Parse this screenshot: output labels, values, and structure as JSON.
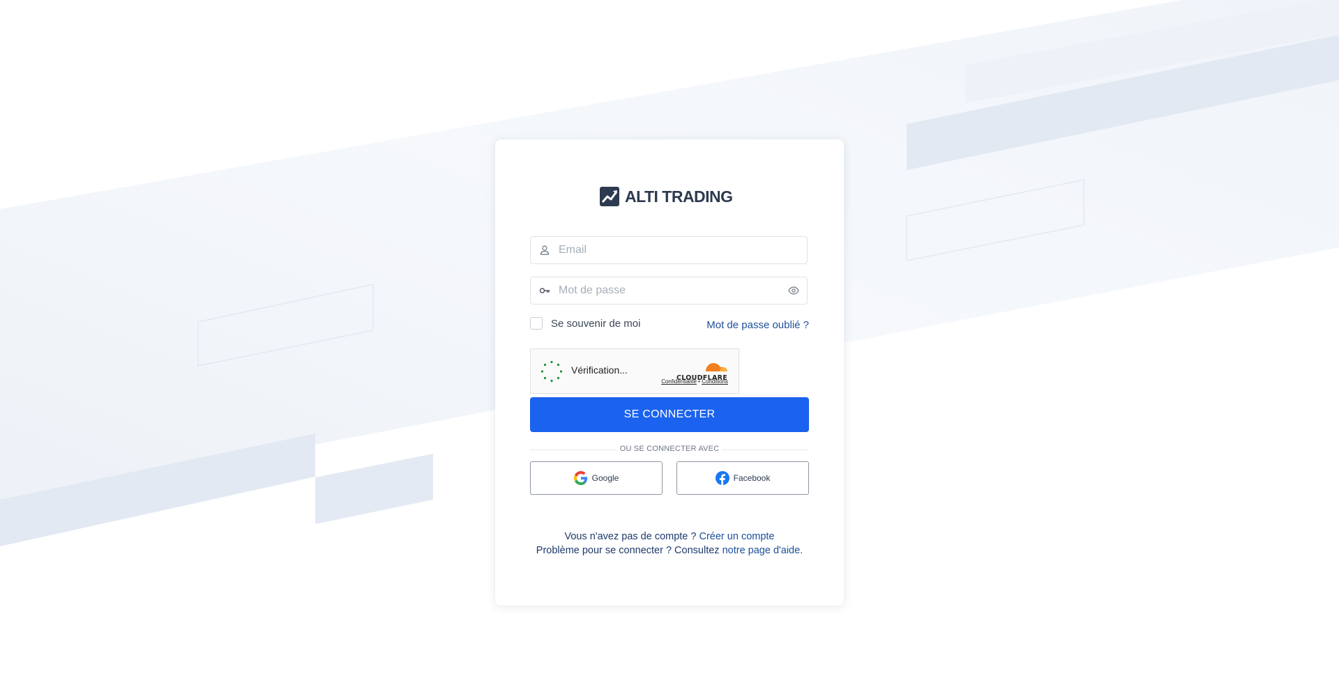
{
  "brand": {
    "name": "ALTI TRADING",
    "logo_icon": "chart-line-icon"
  },
  "form": {
    "email_placeholder": "Email",
    "email_value": "",
    "password_placeholder": "Mot de passe",
    "password_value": "",
    "remember_label": "Se souvenir de moi",
    "remember_checked": false,
    "forgot_link": "Mot de passe oublié ?",
    "submit_label": "SE CONNECTER"
  },
  "captcha": {
    "status": "Vérification...",
    "provider": "CLOUDFLARE",
    "privacy_link": "Confidentialité",
    "separator": "•",
    "terms_link": "Conditions"
  },
  "social": {
    "divider": "OU SE CONNECTER AVEC",
    "google_label": "Google",
    "facebook_label": "Facebook"
  },
  "footer": {
    "no_account_text": "Vous n'avez pas de compte ? ",
    "create_account_link": "Créer un compte",
    "problem_text": "Problème pour se connecter ? Consultez ",
    "help_link": "notre page d'aide."
  },
  "colors": {
    "primary": "#1b62ee",
    "link": "#1d4f9c",
    "logo": "#2d3a4f",
    "cloudflare_orange": "#f38020"
  }
}
